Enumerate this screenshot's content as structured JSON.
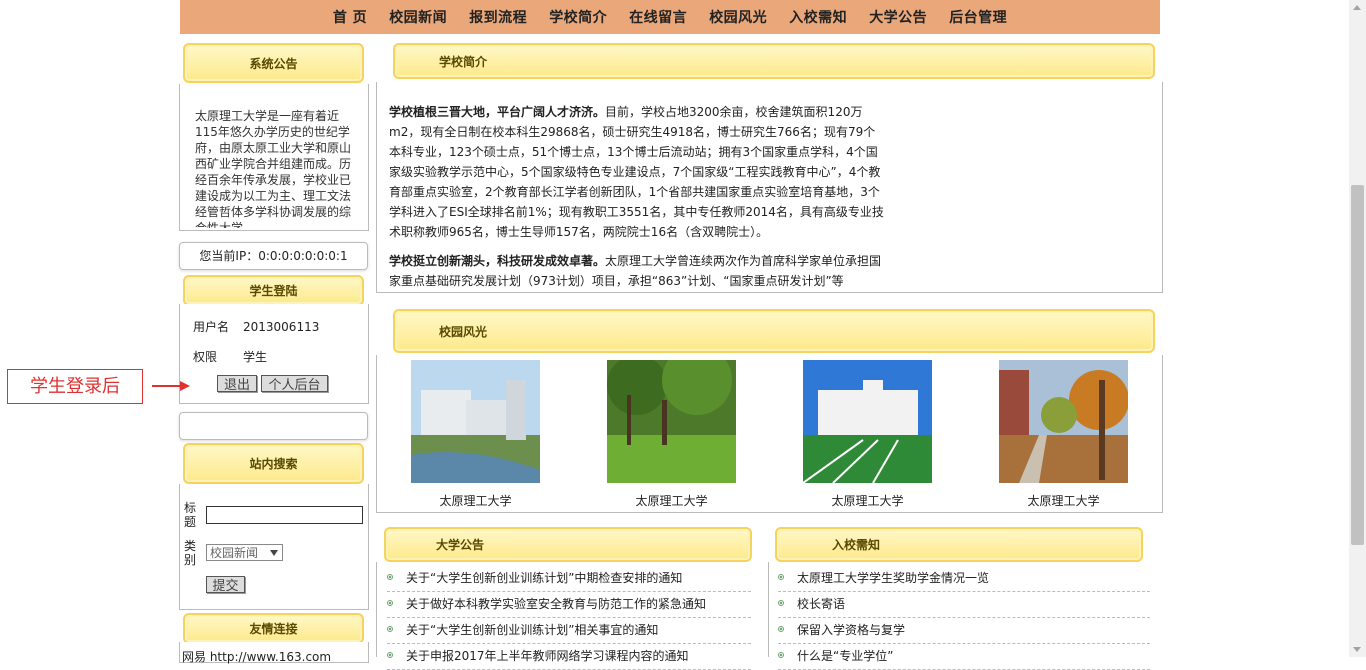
{
  "nav": [
    "首 页",
    "校园新闻",
    "报到流程",
    "学校简介",
    "在线留言",
    "校园风光",
    "入校需知",
    "大学公告",
    "后台管理"
  ],
  "sidebar": {
    "notice_title": "系统公告",
    "notice_text": "太原理工大学是一座有着近115年悠久办学历史的世纪学府，由原太原工业大学和原山西矿业学院合并组建而成。历经百余年传承发展，学校业已建设成为以工为主、理工文法经管哲体多学科协调发展的综合性大学。",
    "ip_text": "您当前IP：0:0:0:0:0:0:0:1",
    "login_title": "学生登陆",
    "username_label": "用户名",
    "username_value": "2013006113",
    "role_label": "权限",
    "role_value": "学生",
    "logout_button": "退出",
    "personal_button": "个人后台",
    "search_title": "站内搜索",
    "search_title_label": "标题",
    "search_category_label": "类别",
    "search_category_value": "校园新闻",
    "submit_button": "提交",
    "friend_title": "友情连接",
    "friend_link": "网易 http://www.163.com"
  },
  "annotation": "学生登录后",
  "main": {
    "intro_title": "学校简介",
    "intro_p1_bold": "学校植根三晋大地，平台广阔人才济济。",
    "intro_p1": "目前，学校占地3200余亩，校舍建筑面积120万m2，现有全日制在校本科生29868名，硕士研究生4918名，博士研究生766名；现有79个本科专业，123个硕士点，51个博士点，13个博士后流动站；拥有3个国家重点学科，4个国家级实验教学示范中心，5个国家级特色专业建设点，7个国家级“工程实践教育中心”，4个教育部重点实验室，2个教育部长江学者创新团队，1个省部共建国家重点实验室培育基地，3个学科进入了ESI全球排名前1%；现有教职工3551名，其中专任教师2014名，具有高级专业技术职称教师965名，博士生导师157名，两院院士16名（含双聘院士）。",
    "intro_p2_bold": "学校挺立创新潮头，科技研发成效卓著。",
    "intro_p2": "太原理工大学曾连续两次作为首席科学家单位承担国家重点基础研究发展计划（973计划）项目，承担“863”计划、“国家重点研发计划”等",
    "gallery_title": "校园风光",
    "gallery": [
      {
        "caption": "太原理工大学"
      },
      {
        "caption": "太原理工大学"
      },
      {
        "caption": "太原理工大学"
      },
      {
        "caption": "太原理工大学"
      }
    ],
    "announce_title": "大学公告",
    "announcements": [
      "关于“大学生创新创业训练计划”中期检查安排的通知",
      "关于做好本科教学实验室安全教育与防范工作的紧急通知",
      "关于“大学生创新创业训练计划”相关事宜的通知",
      "关于申报2017年上半年教师网络学习课程内容的通知"
    ],
    "entry_title": "入校需知",
    "entry_items": [
      "太原理工大学学生奖助学金情况一览",
      "校长寄语",
      "保留入学资格与复学",
      "什么是“专业学位”"
    ]
  }
}
